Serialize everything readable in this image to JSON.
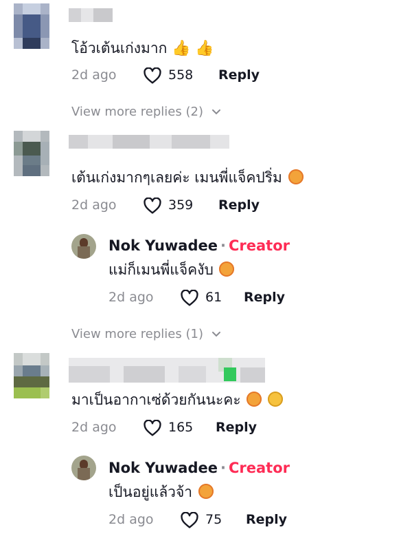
{
  "comments": [
    {
      "text": "โอ้วเต้นเก่งมาก",
      "emojis": [
        "thumbs-up",
        "thumbs-up"
      ],
      "time": "2d ago",
      "likes": "558",
      "reply_label": "Reply",
      "more_replies": "View more replies (2)"
    },
    {
      "text": "เต้นเก่งมากๆเลยค่ะ เมนพี่แจ็คปริ่ม",
      "emojis": [
        "smiling-face-with-hearts"
      ],
      "time": "2d ago",
      "likes": "359",
      "reply_label": "Reply",
      "reply": {
        "author": "Nok Yuwadee",
        "dot": "·",
        "badge": "Creator",
        "text": "แม่ก็เมนพี่แจ็คงับ",
        "emojis": [
          "smiling-face-with-hearts"
        ],
        "time": "2d ago",
        "likes": "61",
        "reply_label": "Reply"
      },
      "more_replies": "View more replies (1)"
    },
    {
      "text": "มาเป็นอากาเซ่ด้วยกันนะคะ",
      "emojis": [
        "smiling-face-with-hearts",
        "face-with-tears-of-joy"
      ],
      "time": "2d ago",
      "likes": "165",
      "reply_label": "Reply",
      "reply": {
        "author": "Nok Yuwadee",
        "dot": "·",
        "badge": "Creator",
        "text": "เป็นอยู่แล้วจ้า",
        "emojis": [
          "smiling-face-with-hearts"
        ],
        "time": "2d ago",
        "likes": "75",
        "reply_label": "Reply"
      }
    }
  ],
  "colors": {
    "creator_badge": "#fe2c55",
    "muted_text": "#8a8b91",
    "primary_text": "#161823"
  }
}
